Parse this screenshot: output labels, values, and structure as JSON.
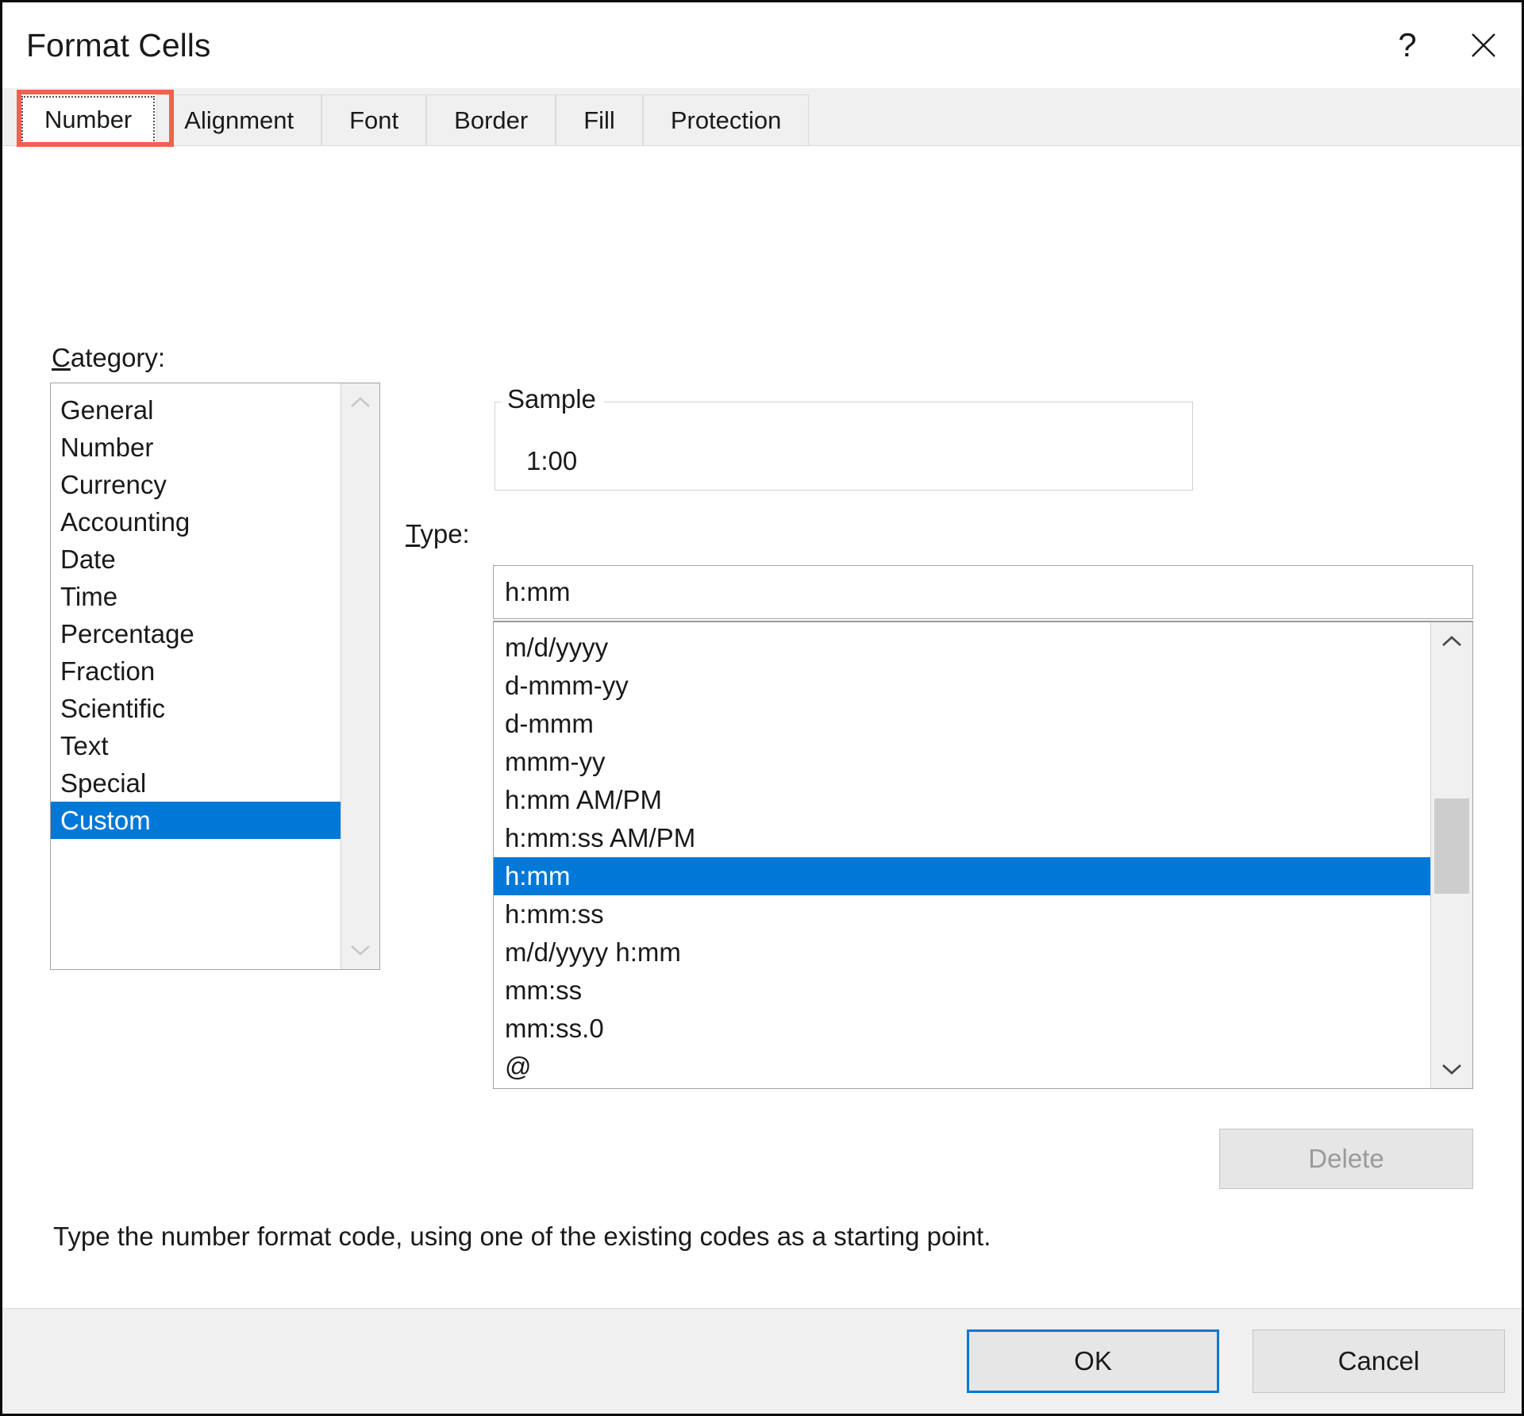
{
  "window": {
    "title": "Format Cells",
    "help_icon": "question-mark-icon",
    "close_icon": "close-icon"
  },
  "tabs": [
    {
      "label": "Number",
      "selected": true
    },
    {
      "label": "Alignment",
      "selected": false
    },
    {
      "label": "Font",
      "selected": false
    },
    {
      "label": "Border",
      "selected": false
    },
    {
      "label": "Fill",
      "selected": false
    },
    {
      "label": "Protection",
      "selected": false
    }
  ],
  "annotation": {
    "target": "Number",
    "color": "#f4604e"
  },
  "category": {
    "label_prefix": "C",
    "label_rest": "ategory:",
    "items": [
      "General",
      "Number",
      "Currency",
      "Accounting",
      "Date",
      "Time",
      "Percentage",
      "Fraction",
      "Scientific",
      "Text",
      "Special",
      "Custom"
    ],
    "selected": "Custom",
    "scroll_up_icon": "chevron-up-icon",
    "scroll_down_icon": "chevron-down-icon"
  },
  "sample": {
    "legend": "Sample",
    "value": "1:00"
  },
  "type": {
    "label_prefix": "T",
    "label_rest": "ype:",
    "input_value": "h:mm",
    "input_placeholder": "",
    "items": [
      "m/d/yyyy",
      "d-mmm-yy",
      "d-mmm",
      "mmm-yy",
      "h:mm AM/PM",
      "h:mm:ss AM/PM",
      "h:mm",
      "h:mm:ss",
      "m/d/yyyy h:mm",
      "mm:ss",
      "mm:ss.0",
      "@"
    ],
    "selected": "h:mm",
    "scroll_up_icon": "chevron-up-icon",
    "scroll_down_icon": "chevron-down-icon"
  },
  "delete_button": {
    "label": "Delete",
    "enabled": false
  },
  "hint": "Type the number format code, using one of the existing codes as a starting point.",
  "footer": {
    "ok_label": "OK",
    "cancel_label": "Cancel",
    "accent": "#0078d7"
  },
  "colors": {
    "selection_blue": "#0078d7",
    "annotation_red": "#f4604e",
    "dialog_chrome": "#f0f0f0"
  }
}
